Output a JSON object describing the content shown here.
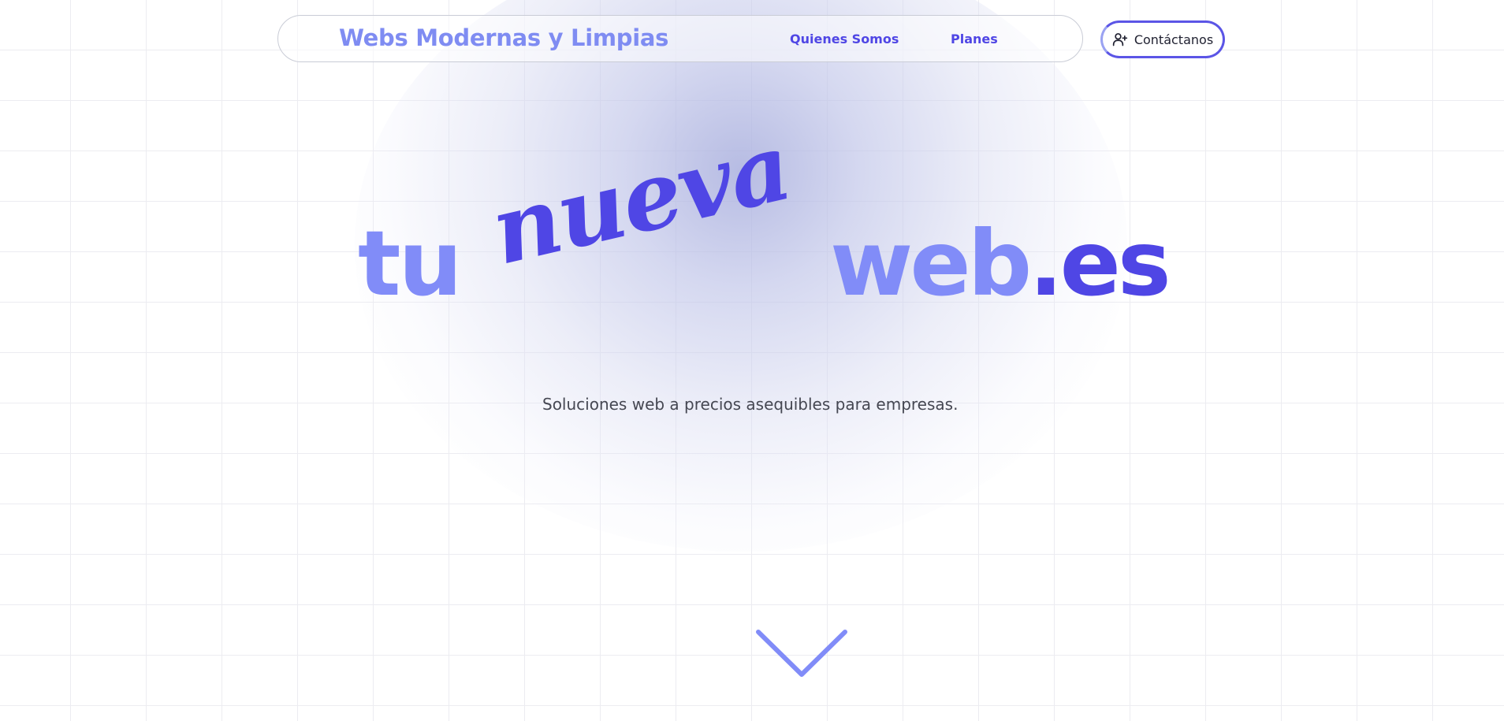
{
  "header": {
    "brand": "Webs Modernas y Limpias",
    "nav": [
      {
        "label": "Quienes Somos"
      },
      {
        "label": "Planes"
      }
    ],
    "contact_button": {
      "label": "Contáctanos",
      "icon": "user-plus-icon"
    }
  },
  "hero": {
    "word_tu": "tu",
    "word_nueva": "nueva",
    "word_web": "web",
    "word_dot": ".",
    "word_es": "es",
    "subtitle": "Soluciones web a precios asequibles para empresas."
  },
  "scroll_icon": "chevron-down-icon",
  "colors": {
    "primary": "#4f46e5",
    "light": "#818cf8",
    "text": "#454752",
    "grid": "#ececf1"
  }
}
